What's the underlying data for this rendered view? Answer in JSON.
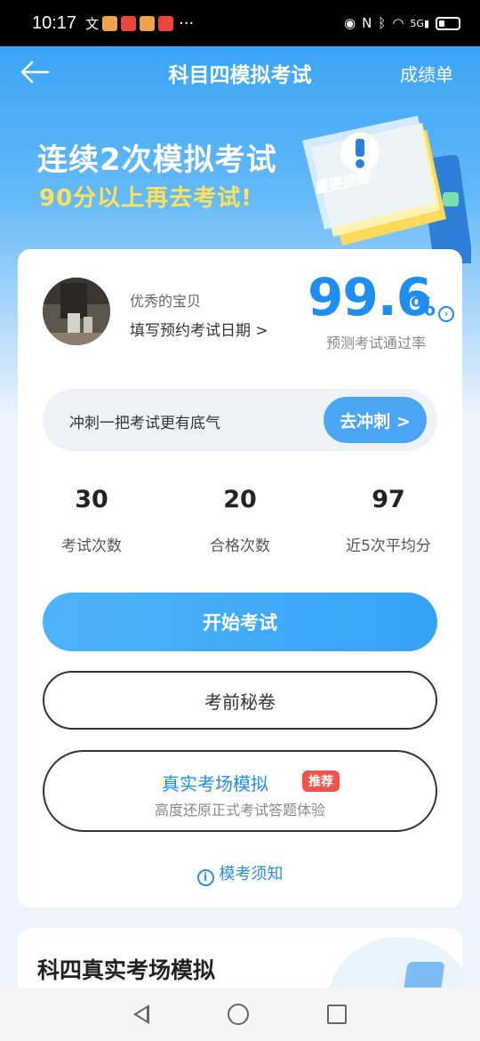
{
  "status_bar": {
    "time": "10:17",
    "more": "···",
    "network_badge": "5G",
    "colors": {
      "background": "#000000",
      "text": "#ffffff"
    }
  },
  "header": {
    "title": "科目四模拟考试",
    "right_link": "成绩单",
    "back_icon": "arrow-left-icon"
  },
  "promo": {
    "line1": "连续2次模拟考试",
    "line2": "90分以上再去考试!",
    "reminder_label": "重要提醒",
    "colors": {
      "line1": "#ffffff",
      "line2": "#ffe15a"
    }
  },
  "profile": {
    "user_name": "优秀的宝贝",
    "exam_date_link": "填写预约考试日期 >"
  },
  "pass_rate": {
    "value": "99.6",
    "unit": "%",
    "label": "预测考试通过率",
    "color": "#1e8ef2"
  },
  "sprint": {
    "text": "冲刺一把考试更有底气",
    "button": "去冲刺 >"
  },
  "stats": [
    {
      "value": "30",
      "label": "考试次数"
    },
    {
      "value": "20",
      "label": "合格次数"
    },
    {
      "value": "97",
      "label": "近5次平均分"
    }
  ],
  "actions": {
    "start_exam": "开始考试",
    "secret_paper": "考前秘卷",
    "real_sim_title": "真实考场模拟",
    "real_sim_badge": "推荐",
    "real_sim_subtitle": "高度还原正式考试答题体验",
    "notice": "模考须知"
  },
  "section2": {
    "title": "科四真实考场模拟"
  },
  "accent_color": "#35a3f6",
  "badge_color": "#f2544b"
}
